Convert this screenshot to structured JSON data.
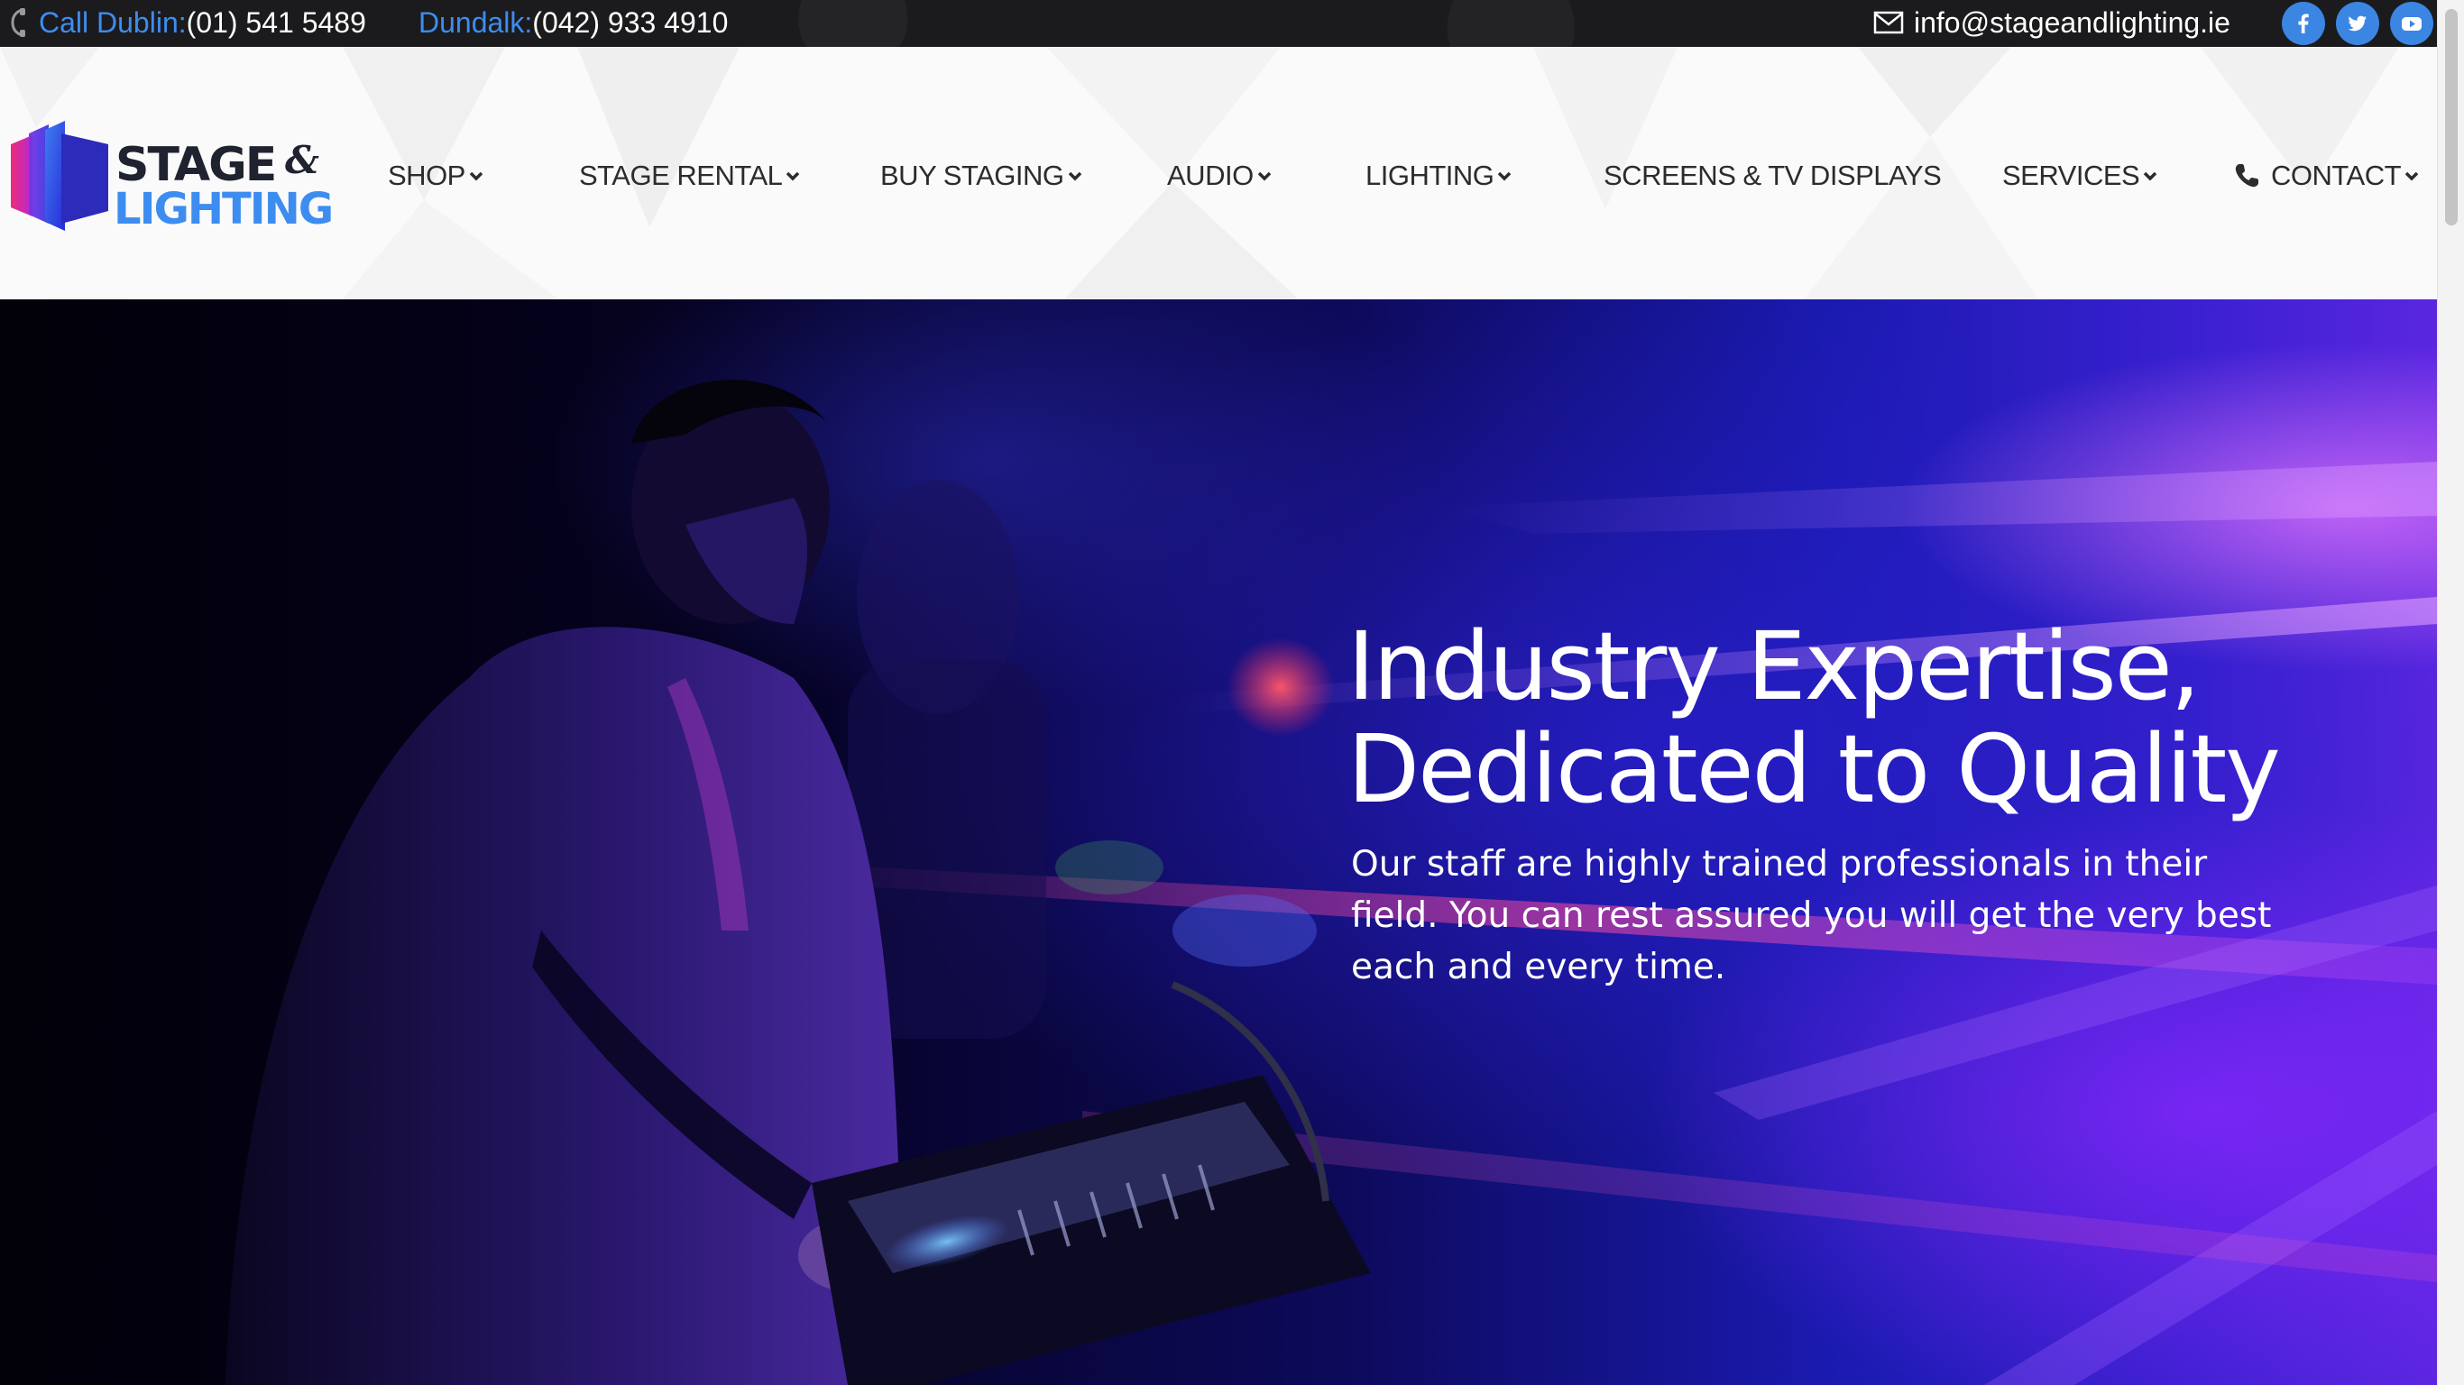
{
  "topbar": {
    "dublin_label": "Call Dublin:",
    "dublin_number": "(01) 541 5489",
    "dundalk_label": "Dundalk:",
    "dundalk_number": "(042) 933 4910",
    "email": "info@stageandlighting.ie",
    "social": [
      "facebook-icon",
      "twitter-icon",
      "youtube-icon"
    ]
  },
  "logo": {
    "line1": "STAGE",
    "amp": "&",
    "line2": "LIGHTING"
  },
  "nav": {
    "items": [
      {
        "label": "SHOP",
        "dropdown": true
      },
      {
        "label": "STAGE RENTAL",
        "dropdown": true
      },
      {
        "label": "BUY STAGING",
        "dropdown": true
      },
      {
        "label": "AUDIO",
        "dropdown": true
      },
      {
        "label": "LIGHTING",
        "dropdown": true
      },
      {
        "label": "SCREENS & TV DISPLAYS",
        "dropdown": false
      },
      {
        "label": "SERVICES",
        "dropdown": true
      },
      {
        "label": "CONTACT",
        "dropdown": true
      }
    ]
  },
  "hero": {
    "title_line1": "Industry Expertise,",
    "title_line2": "Dedicated to Quality",
    "subtitle": "Our staff are highly trained professionals in their field. You can rest assured you will get the very best each and every time."
  },
  "colors": {
    "accent_blue": "#3d8df0",
    "social_blue": "#3b86e3",
    "topbar_bg": "#1b1b1d",
    "nav_text": "#2c2c2c"
  }
}
